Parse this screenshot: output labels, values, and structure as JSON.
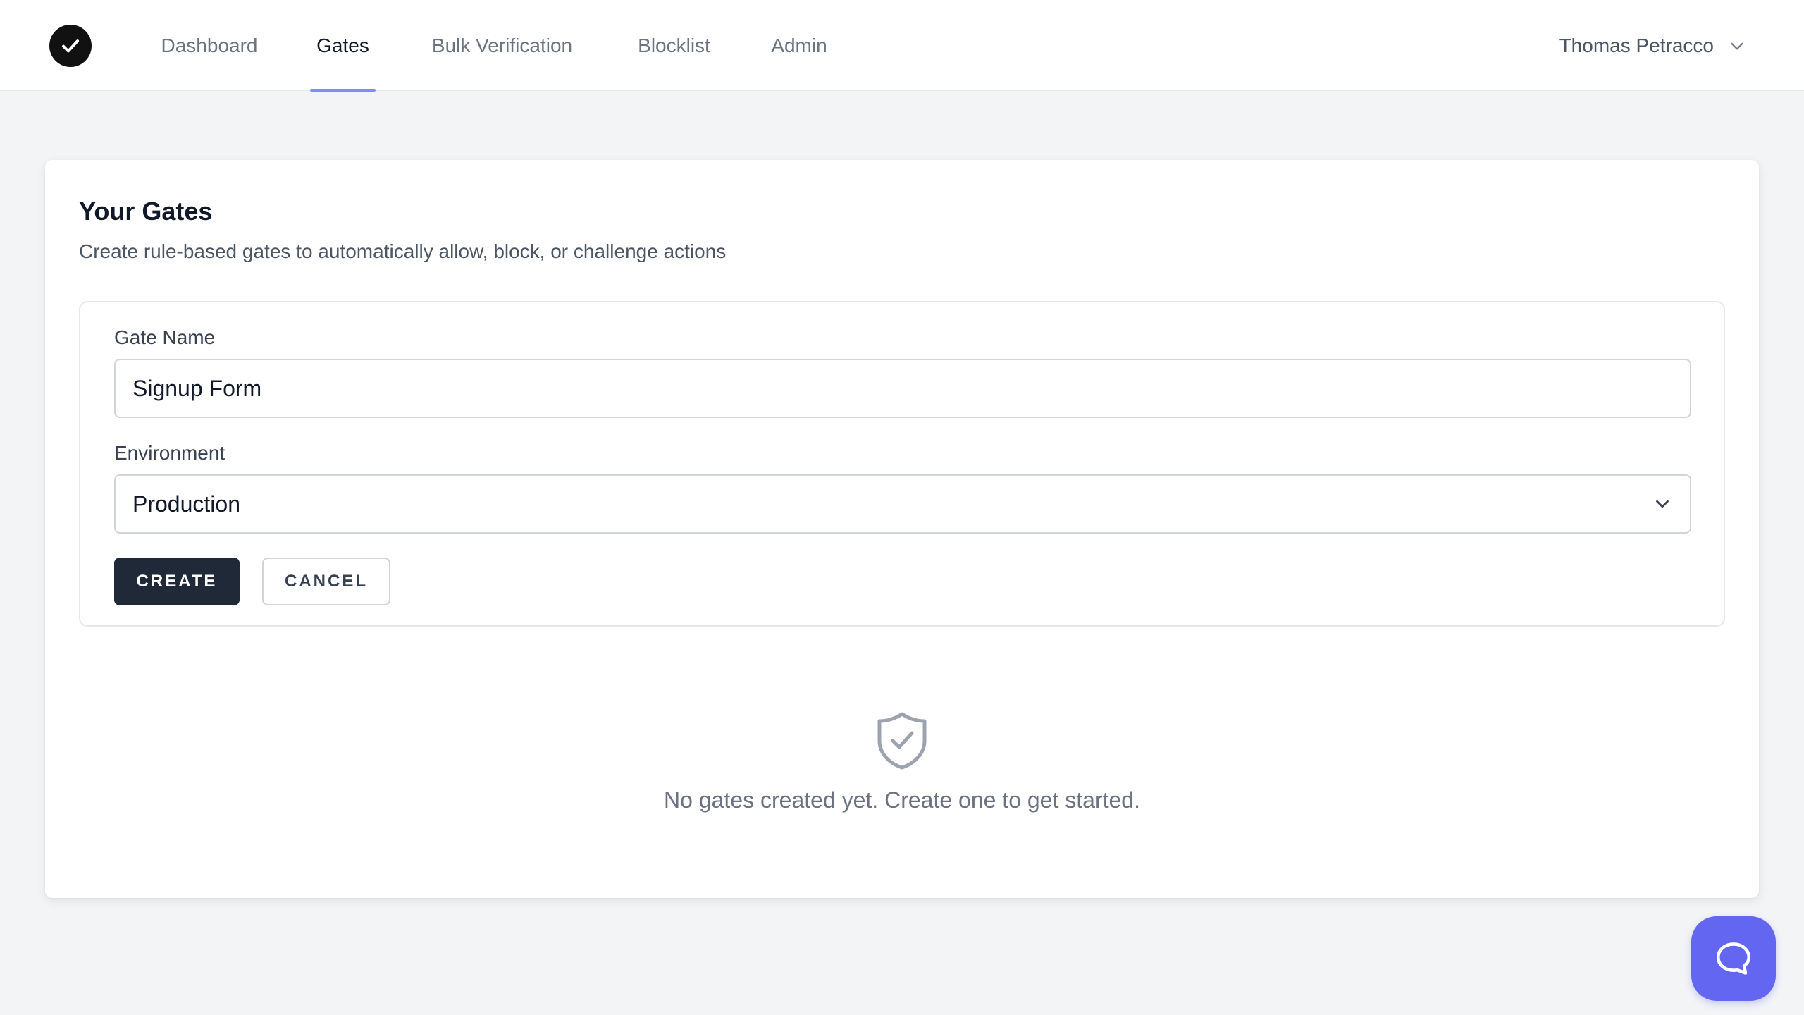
{
  "nav": {
    "items": [
      {
        "label": "Dashboard"
      },
      {
        "label": "Gates"
      },
      {
        "label": "Bulk Verification"
      },
      {
        "label": "Blocklist"
      },
      {
        "label": "Admin"
      }
    ],
    "active": "Gates",
    "user": "Thomas Petracco"
  },
  "page": {
    "title": "Your Gates",
    "subtitle": "Create rule-based gates to automatically allow, block, or challenge actions"
  },
  "form": {
    "gate_name_label": "Gate Name",
    "gate_name_value": "Signup Form",
    "environment_label": "Environment",
    "environment_value": "Production",
    "create_label": "CREATE",
    "cancel_label": "CANCEL"
  },
  "empty_state": {
    "text": "No gates created yet. Create one to get started.",
    "icon": "shield-check-icon"
  },
  "icons": {
    "logo": "check-circle-icon",
    "user_menu": "chevron-down-icon",
    "select": "chevron-down-icon",
    "chat": "chat-bubble-icon"
  },
  "colors": {
    "accent": "#818cf8",
    "primary_button": "#1f2937",
    "chat_button": "#6366f1",
    "background": "#f3f4f6"
  }
}
